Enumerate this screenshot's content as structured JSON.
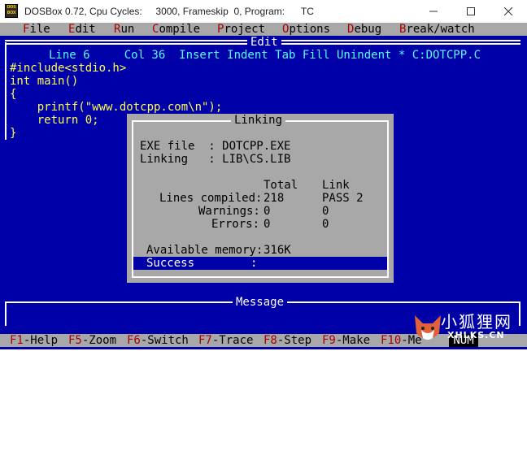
{
  "window": {
    "title": "DOSBox 0.72, Cpu Cycles:     3000, Frameskip  0, Program:      TC",
    "icon_label_top": "DOS",
    "icon_label_bottom": "BOX"
  },
  "menu": {
    "items": [
      {
        "hot": "F",
        "rest": "ile"
      },
      {
        "hot": "E",
        "rest": "dit"
      },
      {
        "hot": "R",
        "rest": "un"
      },
      {
        "hot": "C",
        "rest": "ompile"
      },
      {
        "hot": "P",
        "rest": "roject"
      },
      {
        "hot": "O",
        "rest": "ptions"
      },
      {
        "hot": "D",
        "rest": "ebug"
      },
      {
        "hot": "B",
        "rest": "reak/watch"
      }
    ]
  },
  "editor": {
    "title": "Edit",
    "status": "Line 6     Col 36  Insert Indent Tab Fill Unindent * C:DOTCPP.C",
    "code_lines": [
      "#include<stdio.h>",
      "int main()",
      "{",
      "    printf(\"www.dotcpp.com\\n\");",
      "    return 0;",
      "}"
    ]
  },
  "dialog": {
    "title": "Linking",
    "exe_line": "EXE file  : DOTCPP.EXE",
    "linking_line": "Linking   : LIB\\CS.LIB",
    "col_total": "Total",
    "col_link": "Link",
    "rows": [
      {
        "label": "Lines compiled:",
        "total": "218",
        "link": "PASS 2"
      },
      {
        "label": "Warnings:",
        "total": "0",
        "link": "0"
      },
      {
        "label": "Errors:",
        "total": "0",
        "link": "0"
      }
    ],
    "memory_label": "Available memory:",
    "memory_value": "316K",
    "success_label": "Success",
    "success_colon": ":"
  },
  "message": {
    "title": "Message"
  },
  "function_keys": [
    {
      "key": "F1",
      "label": "-Help"
    },
    {
      "key": "F5",
      "label": "-Zoom"
    },
    {
      "key": "F6",
      "label": "-Switch"
    },
    {
      "key": "F7",
      "label": "-Trace"
    },
    {
      "key": "F8",
      "label": "-Step"
    },
    {
      "key": "F9",
      "label": "-Make"
    },
    {
      "key": "F10",
      "label": "-Me"
    }
  ],
  "num_indicator": "NUM",
  "watermark": {
    "text_cn": "小狐狸网",
    "url": "XHLKS.CN"
  },
  "colors": {
    "dos_blue": "#0000a8",
    "dos_gray": "#a8a8a8",
    "dos_cyan": "#54fcfc",
    "dos_yellow": "#fcfc54",
    "dos_red": "#a80000"
  }
}
